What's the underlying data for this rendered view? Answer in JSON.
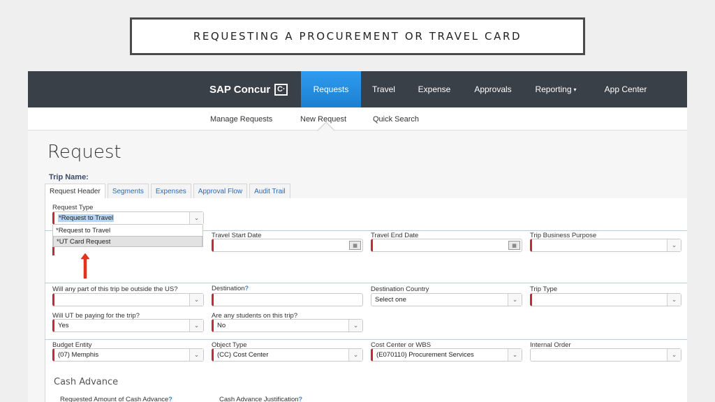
{
  "slide": {
    "title": "REQUESTING A PROCUREMENT OR TRAVEL CARD"
  },
  "topnav": {
    "brand": "SAP Concur",
    "brand_mark": "C·",
    "items": [
      {
        "label": "Requests",
        "active": true
      },
      {
        "label": "Travel"
      },
      {
        "label": "Expense"
      },
      {
        "label": "Approvals"
      },
      {
        "label": "Reporting",
        "caret": "▾"
      },
      {
        "label": "App Center"
      }
    ]
  },
  "subnav": {
    "items": [
      "Manage Requests",
      "New Request",
      "Quick Search"
    ]
  },
  "page": {
    "title": "Request",
    "trip_name_label": "Trip Name:",
    "tabs": [
      "Request Header",
      "Segments",
      "Expenses",
      "Approval Flow",
      "Audit Trail"
    ]
  },
  "form": {
    "request_type": {
      "label": "Request Type",
      "value": "*Request to Travel",
      "options": [
        "*Request to Travel",
        "*UT Card Request"
      ],
      "highlighted_option": "*UT Card Request"
    },
    "travel_start_date": {
      "label": "Travel Start Date",
      "value": ""
    },
    "travel_end_date": {
      "label": "Travel End Date",
      "value": ""
    },
    "trip_business_purpose": {
      "label": "Trip Business Purpose",
      "value": ""
    },
    "outside_us": {
      "label": "Will any part of this trip be outside the US?",
      "value": ""
    },
    "destination": {
      "label": "Destination",
      "value": ""
    },
    "destination_country": {
      "label": "Destination Country",
      "value": "Select one"
    },
    "trip_type": {
      "label": "Trip Type",
      "value": ""
    },
    "ut_paying": {
      "label": "Will UT be paying for the trip?",
      "value": "Yes"
    },
    "students": {
      "label": "Are any students on this trip?",
      "value": "No"
    },
    "budget_entity": {
      "label": "Budget Entity",
      "value": "(07) Memphis"
    },
    "object_type": {
      "label": "Object Type",
      "value": "(CC) Cost Center"
    },
    "cost_center": {
      "label": "Cost Center or WBS",
      "value": "(E070110) Procurement Services"
    },
    "internal_order": {
      "label": "Internal Order",
      "value": ""
    }
  },
  "cash_advance": {
    "title": "Cash Advance",
    "amount_label": "Requested Amount of Cash Advance",
    "justification_label": "Cash Advance Justification"
  },
  "icons": {
    "dropdown": "⌄",
    "help": "?",
    "calendar": "▦"
  },
  "colors": {
    "nav_bg": "#3a4048",
    "nav_active": "#2389df",
    "required_marker": "#c4283c",
    "annotation_arrow": "#e8321e"
  }
}
